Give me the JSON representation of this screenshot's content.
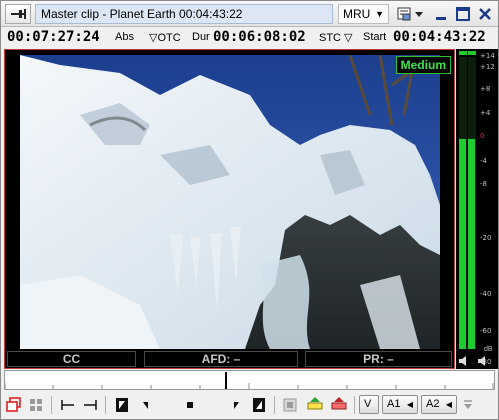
{
  "window": {
    "title": "Master clip - Planet Earth 00:04:43:22",
    "mru_label": "MRU"
  },
  "timecodes": {
    "abs_value": "00:07:27:24",
    "abs_label": "Abs",
    "otc_label": "▽OTC",
    "dur_label": "Dur",
    "dur_value": "00:06:08:02",
    "stc_label": "STC ▽",
    "start_label": "Start",
    "start_value": "00:04:43:22"
  },
  "monitor": {
    "quality_badge": "Medium",
    "status_cc": "CC",
    "status_afd": "AFD: –",
    "status_pr": "PR: –"
  },
  "audio_meter": {
    "scale": [
      "+14",
      "+12",
      "+8",
      "+4",
      "0",
      "-4",
      "-8",
      "-20",
      "-40",
      "-60",
      "-80"
    ],
    "unit": "dB",
    "level_ch1": 0.72,
    "level_ch2": 0.72
  },
  "scrub": {
    "position": 0.45
  },
  "transport": {
    "track_v": "V",
    "track_a1": "A1",
    "track_a2": "A2"
  },
  "colors": {
    "accent_red": "#c23a3a",
    "meter_green": "#1fcc2f",
    "badge_green": "#3fe34a",
    "zero_db_red": "#e03030"
  }
}
